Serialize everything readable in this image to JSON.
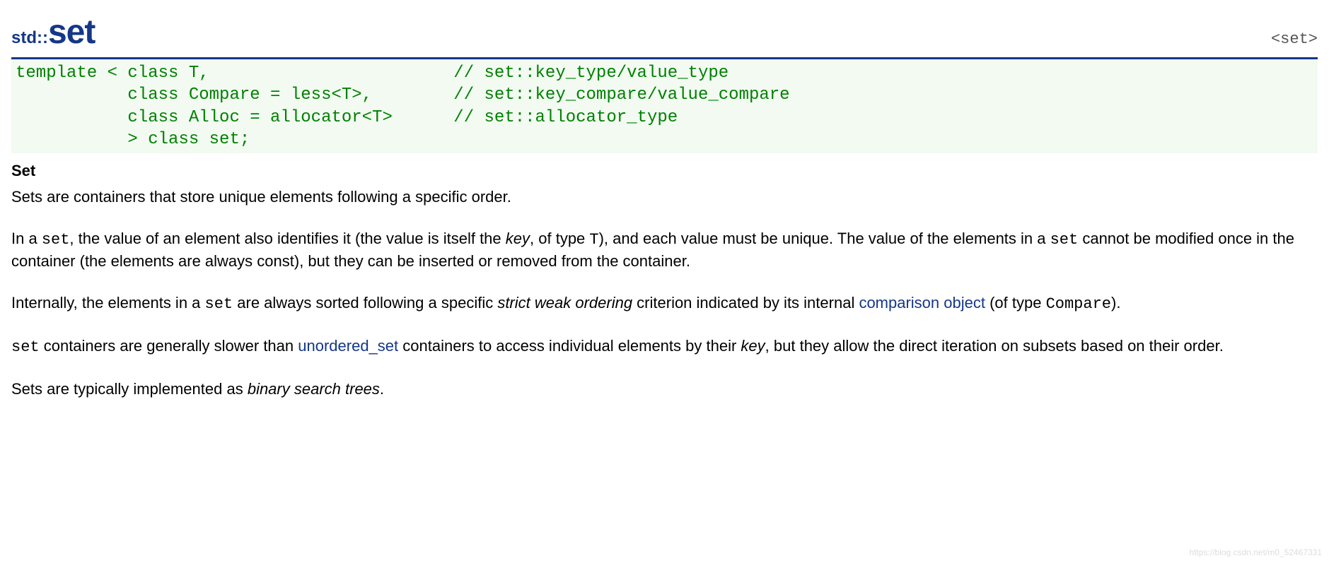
{
  "header": {
    "prefix": "std::",
    "name": "set",
    "include": "<set>"
  },
  "code": {
    "line1": "template < class T,                        // set::key_type/value_type",
    "line2": "           class Compare = less<T>,        // set::key_compare/value_compare",
    "line3": "           class Alloc = allocator<T>      // set::allocator_type",
    "line4": "           > class set;"
  },
  "section_heading": "Set",
  "para1": "Sets are containers that store unique elements following a specific order.",
  "para2": {
    "t1": "In a ",
    "code1": "set",
    "t2": ", the value of an element also identifies it (the value is itself the ",
    "em1": "key",
    "t3": ", of type ",
    "code2": "T",
    "t4": "), and each value must be unique. The value of the elements in a ",
    "code3": "set",
    "t5": " cannot be modified once in the container (the elements are always const), but they can be inserted or removed from the container."
  },
  "para3": {
    "t1": "Internally, the elements in a ",
    "code1": "set",
    "t2": " are always sorted following a specific ",
    "em1": "strict weak ordering",
    "t3": " criterion indicated by its internal ",
    "link1": "comparison object",
    "t4": " (of type ",
    "code2": "Compare",
    "t5": ")."
  },
  "para4": {
    "code1": "set",
    "t1": " containers are generally slower than ",
    "link1": "unordered_set",
    "t2": " containers to access individual elements by their ",
    "em1": "key",
    "t3": ", but they allow the direct iteration on subsets based on their order."
  },
  "para5": {
    "t1": "Sets are typically implemented as ",
    "em1": "binary search trees",
    "t2": "."
  },
  "watermark": "https://blog.csdn.net/m0_52467331"
}
